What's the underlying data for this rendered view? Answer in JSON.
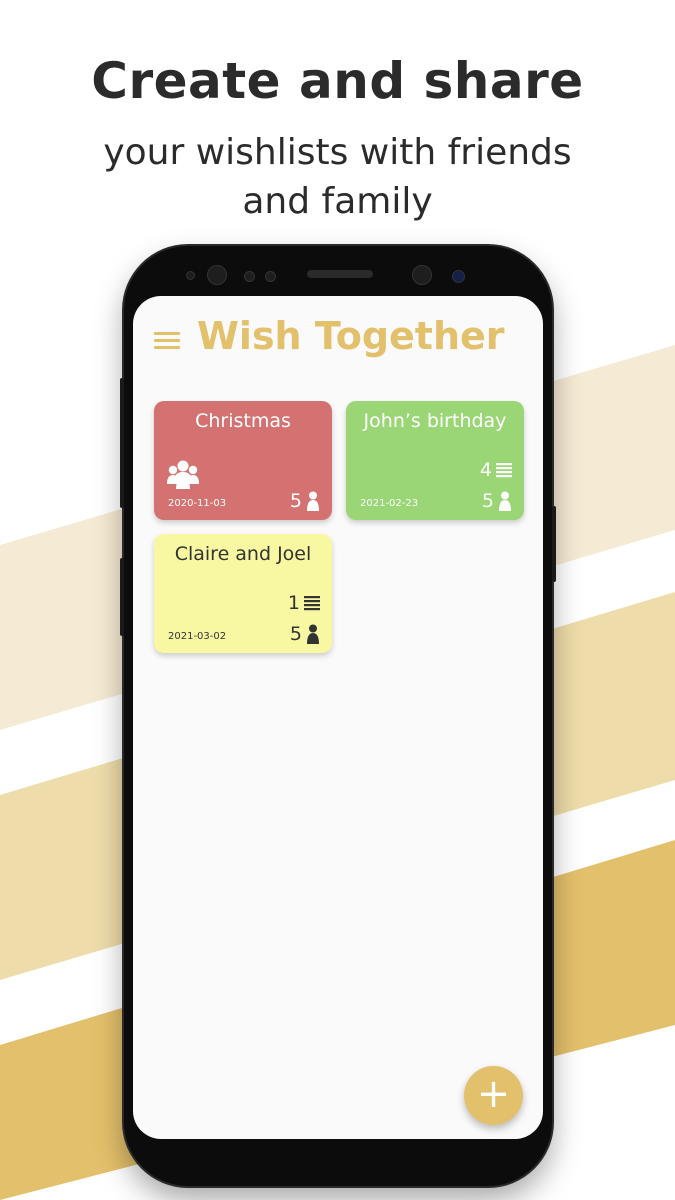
{
  "promo": {
    "headline": "Create and share",
    "subline_1": "your wishlists with friends",
    "subline_2": "and family"
  },
  "app": {
    "title": "Wish Together",
    "menu_icon": "hamburger-menu-icon",
    "accent_color": "#e3c06b"
  },
  "wishlists": [
    {
      "title": "Christmas",
      "date": "2020-11-03",
      "members": "5",
      "color": "#d47272",
      "text_color": "#ffffff",
      "shared_icon": "group-icon"
    },
    {
      "title": "John’s birthday",
      "date": "2021-02-23",
      "items": "4",
      "members": "5",
      "color": "#9ad675",
      "text_color": "#ffffff"
    },
    {
      "title": "Claire and Joel",
      "date": "2021-03-02",
      "items": "1",
      "members": "5",
      "color": "#f8f8a2",
      "text_color": "#333333"
    }
  ],
  "fab": {
    "label": "+",
    "icon": "plus-icon"
  },
  "background": {
    "stripe_light": "#f5ead3",
    "stripe_mid": "#eedcaa",
    "stripe_dark": "#e3c06b"
  }
}
